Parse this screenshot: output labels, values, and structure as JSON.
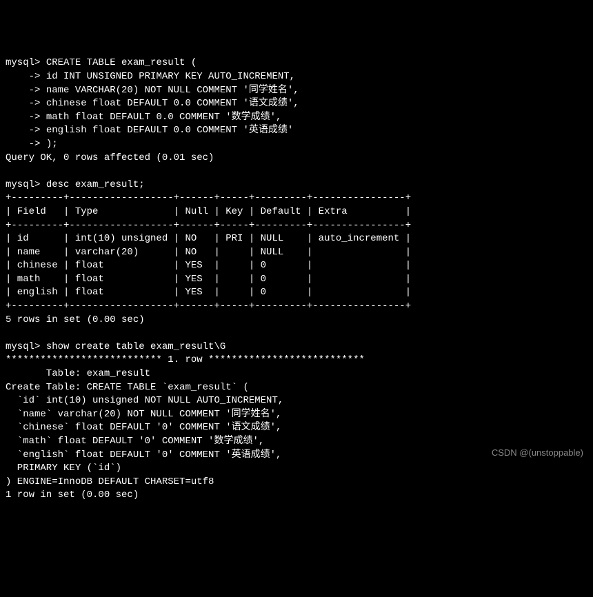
{
  "terminal": {
    "prompt": "mysql> ",
    "cont_prompt": "    -> ",
    "create_table_line1": "CREATE TABLE exam_result (",
    "create_table_line2": "id INT UNSIGNED PRIMARY KEY AUTO_INCREMENT,",
    "create_table_line3": "name VARCHAR(20) NOT NULL COMMENT '同学姓名',",
    "create_table_line4": "chinese float DEFAULT 0.0 COMMENT '语文成绩',",
    "create_table_line5": "math float DEFAULT 0.0 COMMENT '数学成绩',",
    "create_table_line6": "english float DEFAULT 0.0 COMMENT '英语成绩'",
    "create_table_line7": ");",
    "query_ok": "Query OK, 0 rows affected (0.01 sec)",
    "desc_cmd": "desc exam_result;",
    "table_border": "+---------+------------------+------+-----+---------+----------------+",
    "table_header": "| Field   | Type             | Null | Key | Default | Extra          |",
    "table_row1": "| id      | int(10) unsigned | NO   | PRI | NULL    | auto_increment |",
    "table_row2": "| name    | varchar(20)      | NO   |     | NULL    |                |",
    "table_row3": "| chinese | float            | YES  |     | 0       |                |",
    "table_row4": "| math    | float            | YES  |     | 0       |                |",
    "table_row5": "| english | float            | YES  |     | 0       |                |",
    "rows_in_set": "5 rows in set (0.00 sec)",
    "show_create_cmd": "show create table exam_result\\G",
    "row_separator": "*************************** 1. row ***************************",
    "table_label": "       Table: exam_result",
    "create_table_label": "Create Table: CREATE TABLE `exam_result` (",
    "sc_line1": "  `id` int(10) unsigned NOT NULL AUTO_INCREMENT,",
    "sc_line2": "  `name` varchar(20) NOT NULL COMMENT '同学姓名',",
    "sc_line3": "  `chinese` float DEFAULT '0' COMMENT '语文成绩',",
    "sc_line4": "  `math` float DEFAULT '0' COMMENT '数学成绩',",
    "sc_line5": "  `english` float DEFAULT '0' COMMENT '英语成绩',",
    "sc_line6": "  PRIMARY KEY (`id`)",
    "sc_line7": ") ENGINE=InnoDB DEFAULT CHARSET=utf8",
    "one_row": "1 row in set (0.00 sec)"
  },
  "watermark": "CSDN @(unstoppable)"
}
